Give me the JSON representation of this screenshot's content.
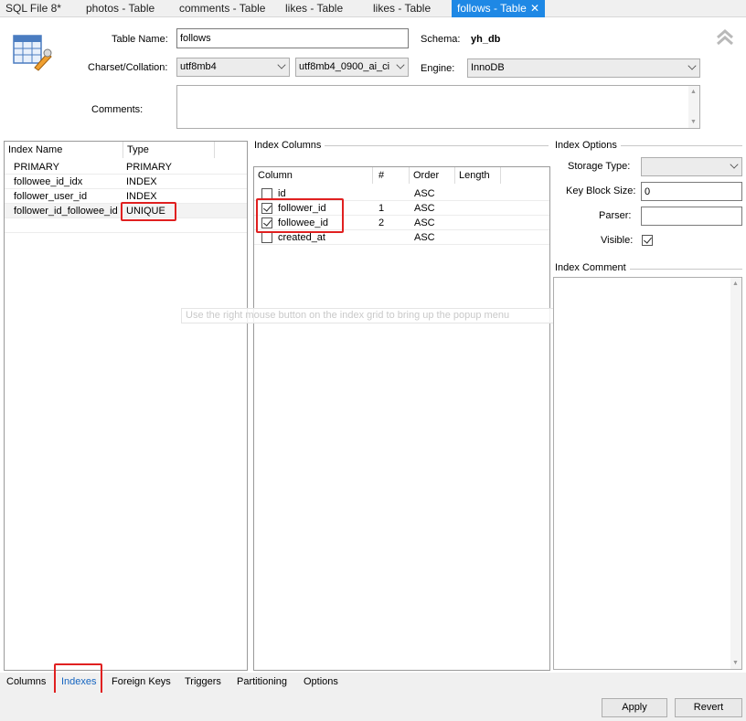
{
  "tabs": [
    {
      "label": "SQL File 8*",
      "active": false
    },
    {
      "label": "photos - Table",
      "active": false
    },
    {
      "label": "comments - Table",
      "active": false
    },
    {
      "label": "likes - Table",
      "active": false
    },
    {
      "label": "likes - Table",
      "active": false
    },
    {
      "label": "follows - Table",
      "active": true
    }
  ],
  "header": {
    "table_name_label": "Table Name:",
    "table_name_value": "follows",
    "schema_label": "Schema:",
    "schema_value": "yh_db",
    "charset_label": "Charset/Collation:",
    "charset_value": "utf8mb4",
    "collation_value": "utf8mb4_0900_ai_ci",
    "engine_label": "Engine:",
    "engine_value": "InnoDB",
    "comments_label": "Comments:",
    "comments_value": ""
  },
  "index_list": {
    "columns": [
      "Index Name",
      "Type"
    ],
    "rows": [
      {
        "name": "PRIMARY",
        "type": "PRIMARY"
      },
      {
        "name": "followee_id_idx",
        "type": "INDEX"
      },
      {
        "name": "follower_user_id",
        "type": "INDEX"
      },
      {
        "name": "follower_id_followee_id",
        "type": "UNIQUE"
      }
    ]
  },
  "index_columns": {
    "title": "Index Columns",
    "columns": [
      "Column",
      "#",
      "Order",
      "Length"
    ],
    "rows": [
      {
        "checked": false,
        "column": "id",
        "num": "",
        "order": "ASC",
        "length": ""
      },
      {
        "checked": true,
        "column": "follower_id",
        "num": "1",
        "order": "ASC",
        "length": ""
      },
      {
        "checked": true,
        "column": "followee_id",
        "num": "2",
        "order": "ASC",
        "length": ""
      },
      {
        "checked": false,
        "column": "created_at",
        "num": "",
        "order": "ASC",
        "length": ""
      }
    ],
    "hint": "Use the right mouse button on the index grid to bring up the popup menu"
  },
  "index_options": {
    "title": "Index Options",
    "storage_type_label": "Storage Type:",
    "storage_type_value": "",
    "key_block_size_label": "Key Block Size:",
    "key_block_size_value": "0",
    "parser_label": "Parser:",
    "parser_value": "",
    "visible_label": "Visible:",
    "visible_checked": true,
    "comment_title": "Index Comment"
  },
  "bottom_tabs": [
    {
      "label": "Columns",
      "active": false
    },
    {
      "label": "Indexes",
      "active": true
    },
    {
      "label": "Foreign Keys",
      "active": false
    },
    {
      "label": "Triggers",
      "active": false
    },
    {
      "label": "Partitioning",
      "active": false
    },
    {
      "label": "Options",
      "active": false
    }
  ],
  "buttons": {
    "apply": "Apply",
    "revert": "Revert"
  },
  "colors": {
    "accent": "#1e88e5",
    "highlight": "#e02020",
    "active_tab_text": "#1565c0"
  }
}
